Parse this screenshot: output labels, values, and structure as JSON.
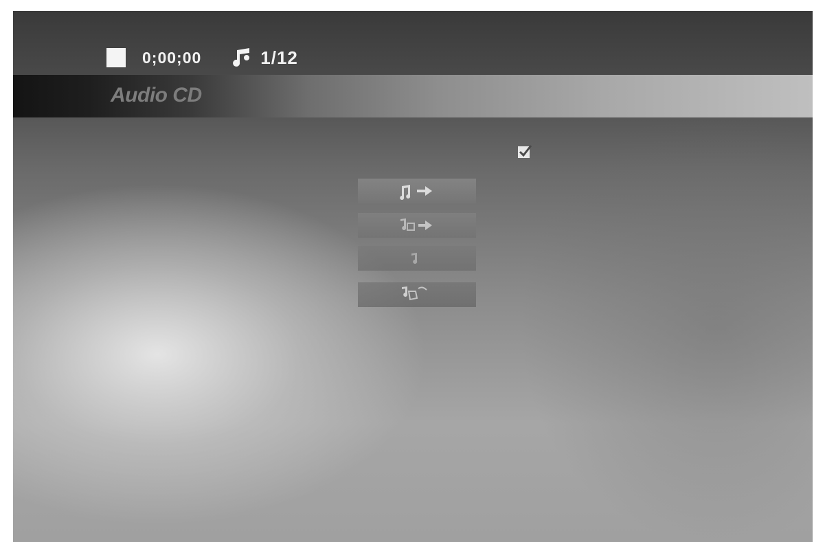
{
  "status": {
    "playback_icon": "stop-icon",
    "time": "0;00;00",
    "track_icon": "music-note-icon",
    "track": "1/12"
  },
  "title_bar": {
    "label": "Audio CD"
  },
  "selection_icon": "checkmark-icon",
  "menu": [
    {
      "icon": "track-forward-icon"
    },
    {
      "icon": "program-forward-icon"
    },
    {
      "icon": "program-icon"
    },
    {
      "icon": "program-clear-icon"
    }
  ],
  "colors": {
    "text_light": "#f2f2f2",
    "title_text": "#7d7d7d",
    "bar_dark": "#141414",
    "bar_light": "#bfbfbf"
  }
}
